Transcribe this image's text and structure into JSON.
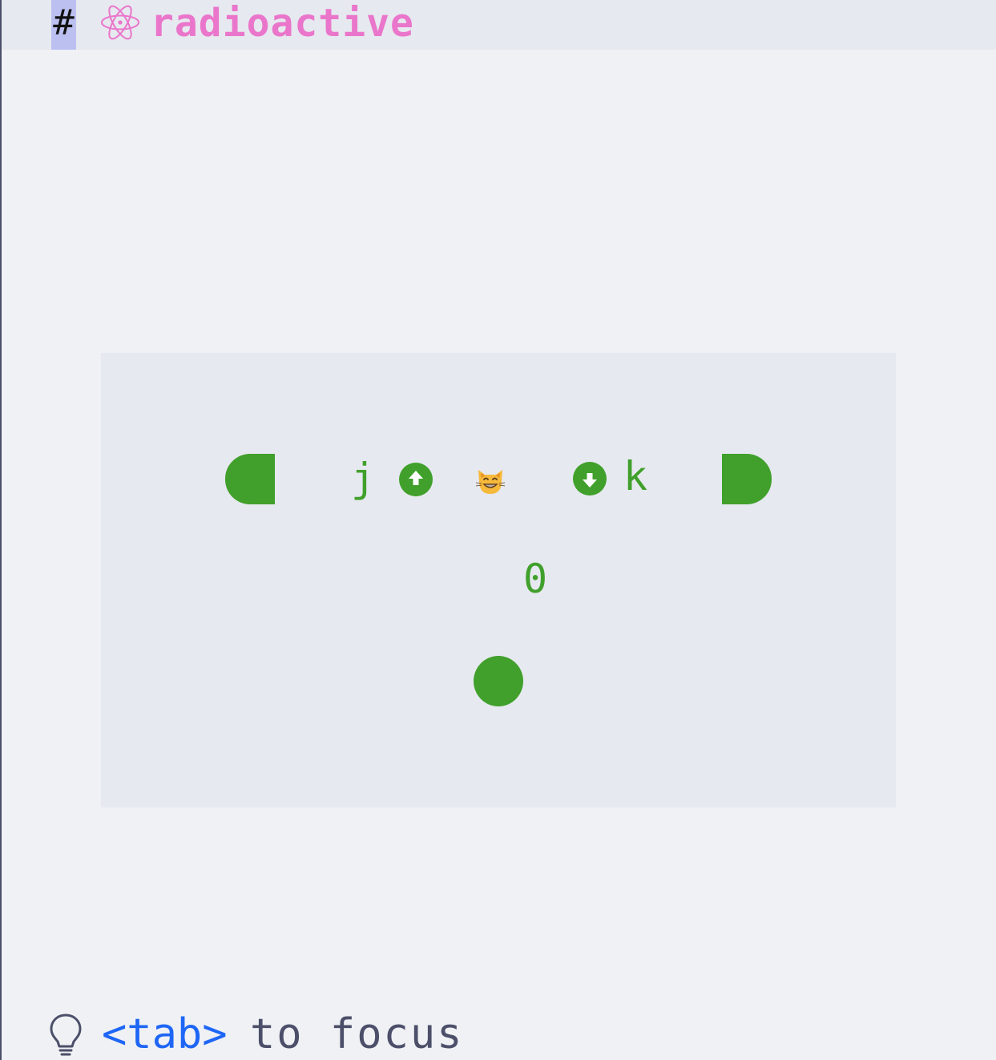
{
  "header": {
    "hash": "#",
    "icon": "atom-icon",
    "title": "radioactive"
  },
  "widget": {
    "left_key": "j",
    "left_icon": "arrow-up-circle-icon",
    "center_icon": "grinning-cat-icon",
    "right_icon": "arrow-down-circle-icon",
    "right_key": "k",
    "counter": "0"
  },
  "footer": {
    "icon": "lightbulb-icon",
    "key": "<tab>",
    "text": "to focus"
  },
  "colors": {
    "background": "#eff1f5",
    "panel": "#e6e9ef",
    "accent": "#40a02b",
    "title": "#ea76cb",
    "highlight": "#bcc0f0",
    "key": "#1e66f5",
    "text": "#4c4f69"
  }
}
